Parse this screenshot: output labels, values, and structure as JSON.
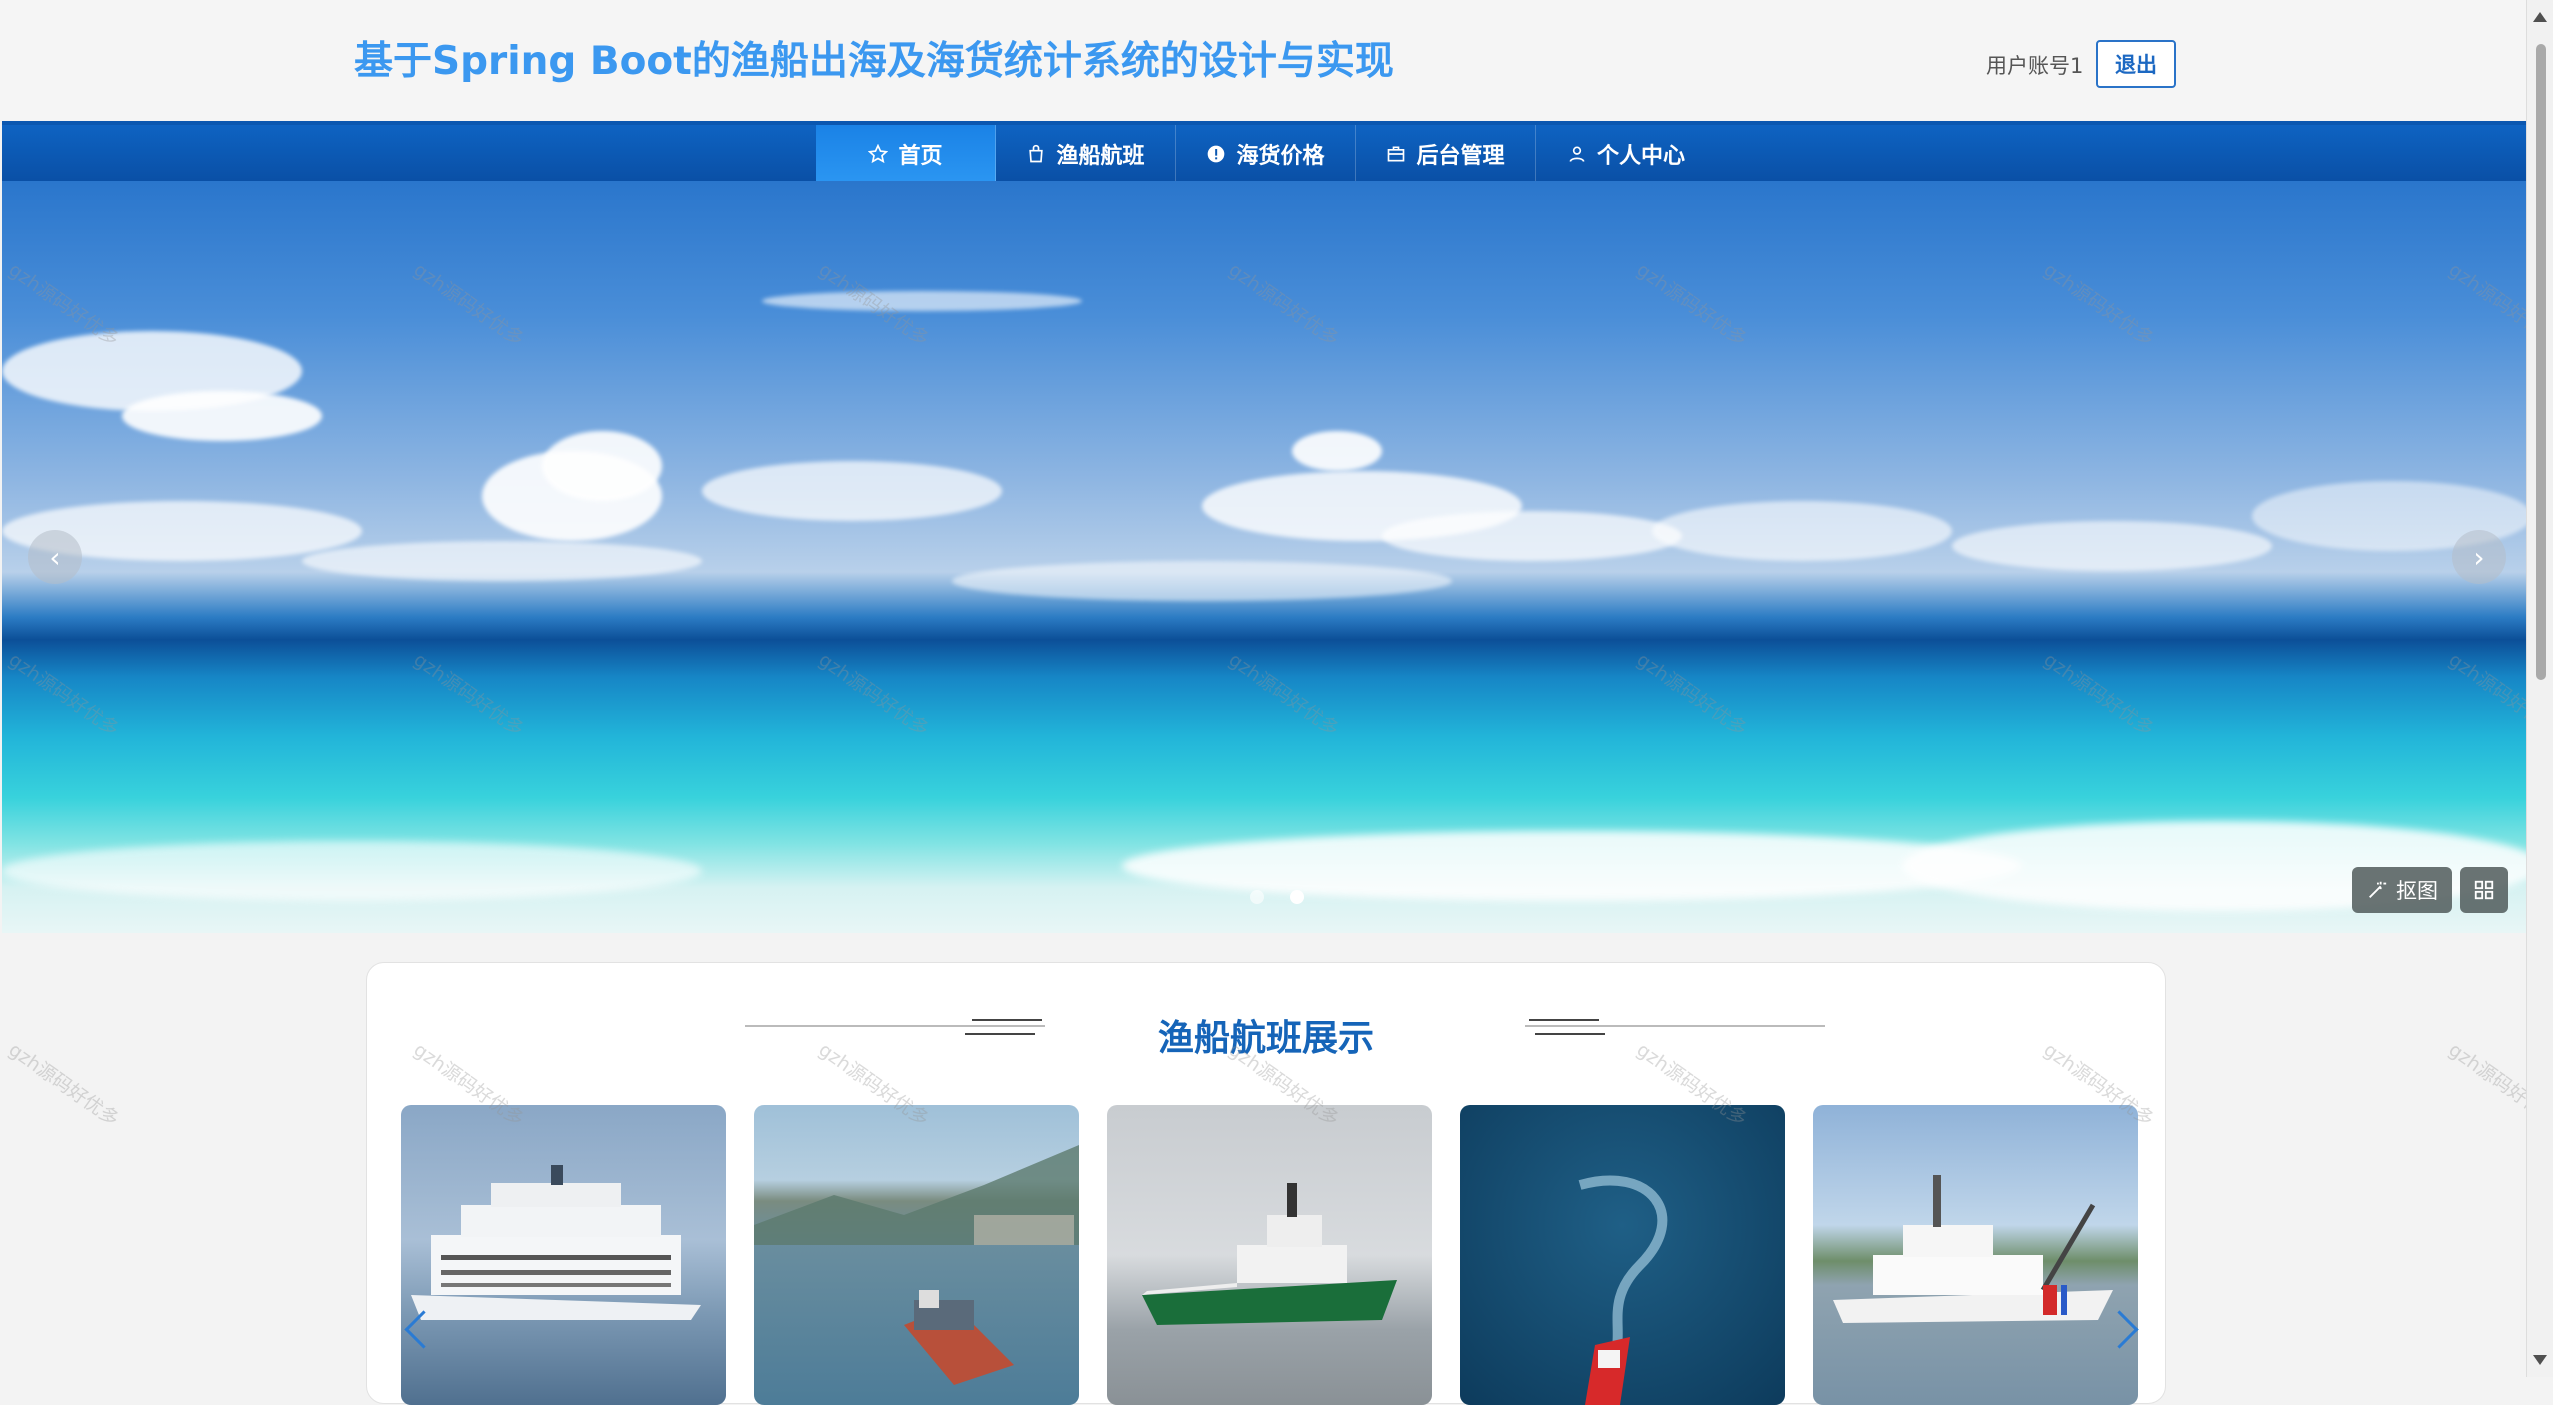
{
  "header": {
    "title": "基于Spring Boot的渔船出海及海货统计系统的设计与实现",
    "user_label": "用户账号1",
    "logout_label": "退出"
  },
  "nav": {
    "items": [
      {
        "label": "首页",
        "icon": "star-icon",
        "active": true
      },
      {
        "label": "渔船航班",
        "icon": "bag-icon",
        "active": false
      },
      {
        "label": "海货价格",
        "icon": "alert-circle-icon",
        "active": false
      },
      {
        "label": "后台管理",
        "icon": "briefcase-icon",
        "active": false
      },
      {
        "label": "个人中心",
        "icon": "user-icon",
        "active": false
      }
    ]
  },
  "banner": {
    "prev_glyph": "‹",
    "next_glyph": "›",
    "slide_count": 2,
    "active_slide": 2,
    "crop_label": "抠图",
    "grid_icon": "grid-icon",
    "crop_icon": "magic-wand-icon"
  },
  "section": {
    "title": "渔船航班展示",
    "cards": [
      {
        "name": "cruise-ship-image"
      },
      {
        "name": "cargo-ship-image"
      },
      {
        "name": "green-vessel-image"
      },
      {
        "name": "red-boat-aerial-image"
      },
      {
        "name": "patrol-vessel-image"
      }
    ]
  },
  "watermark": "gzh源码好优多"
}
